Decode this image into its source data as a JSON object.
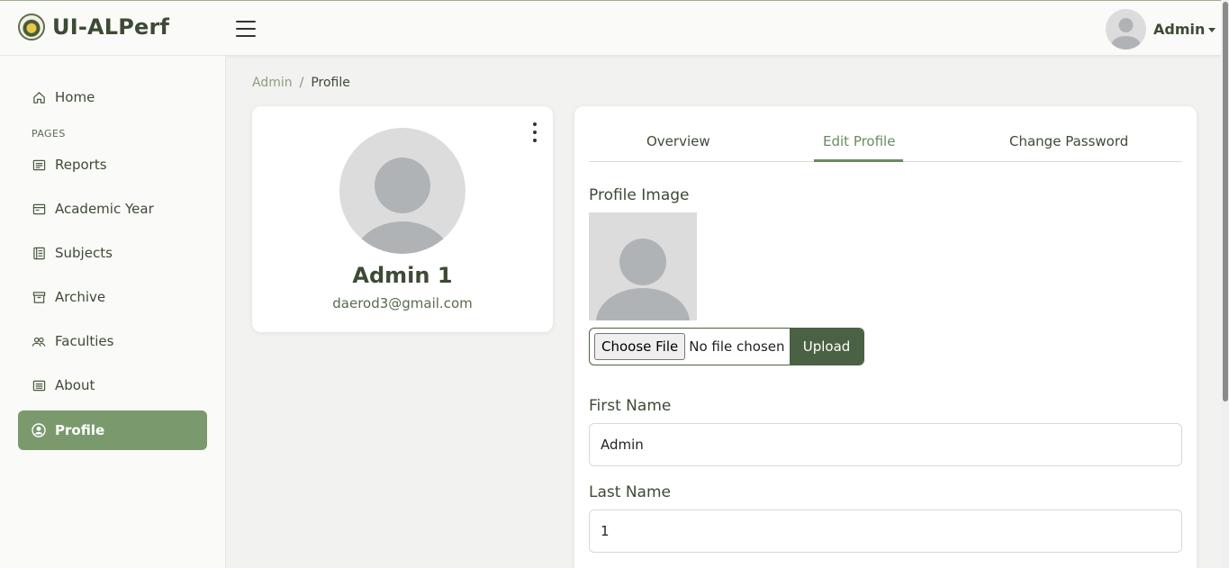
{
  "header": {
    "brand": "UI-ALPerf",
    "user_name": "Admin"
  },
  "sidebar": {
    "items": [
      {
        "label": "Home",
        "icon": "home-icon"
      },
      {
        "label": "Reports",
        "icon": "reports-icon"
      },
      {
        "label": "Academic Year",
        "icon": "calendar-card-icon"
      },
      {
        "label": "Subjects",
        "icon": "book-icon"
      },
      {
        "label": "Archive",
        "icon": "archive-icon"
      },
      {
        "label": "Faculties",
        "icon": "people-icon"
      },
      {
        "label": "About",
        "icon": "list-icon"
      },
      {
        "label": "Profile",
        "icon": "person-circle-icon"
      }
    ],
    "section_label": "PAGES",
    "active": "Profile"
  },
  "breadcrumb": {
    "parent": "Admin",
    "separator": "/",
    "current": "Profile"
  },
  "profile_card": {
    "name": "Admin 1",
    "email": "daerod3@gmail.com"
  },
  "tabs": [
    {
      "label": "Overview"
    },
    {
      "label": "Edit Profile"
    },
    {
      "label": "Change Password"
    }
  ],
  "active_tab": "Edit Profile",
  "form": {
    "profile_image_label": "Profile Image",
    "choose_file_label": "Choose File",
    "no_file_text": "No file chosen",
    "upload_label": "Upload",
    "first_name_label": "First Name",
    "first_name_value": "Admin",
    "last_name_label": "Last Name",
    "last_name_value": "1"
  },
  "colors": {
    "accent": "#7a9a6e",
    "dark_green": "#4b6143",
    "text": "#3d4a35"
  }
}
